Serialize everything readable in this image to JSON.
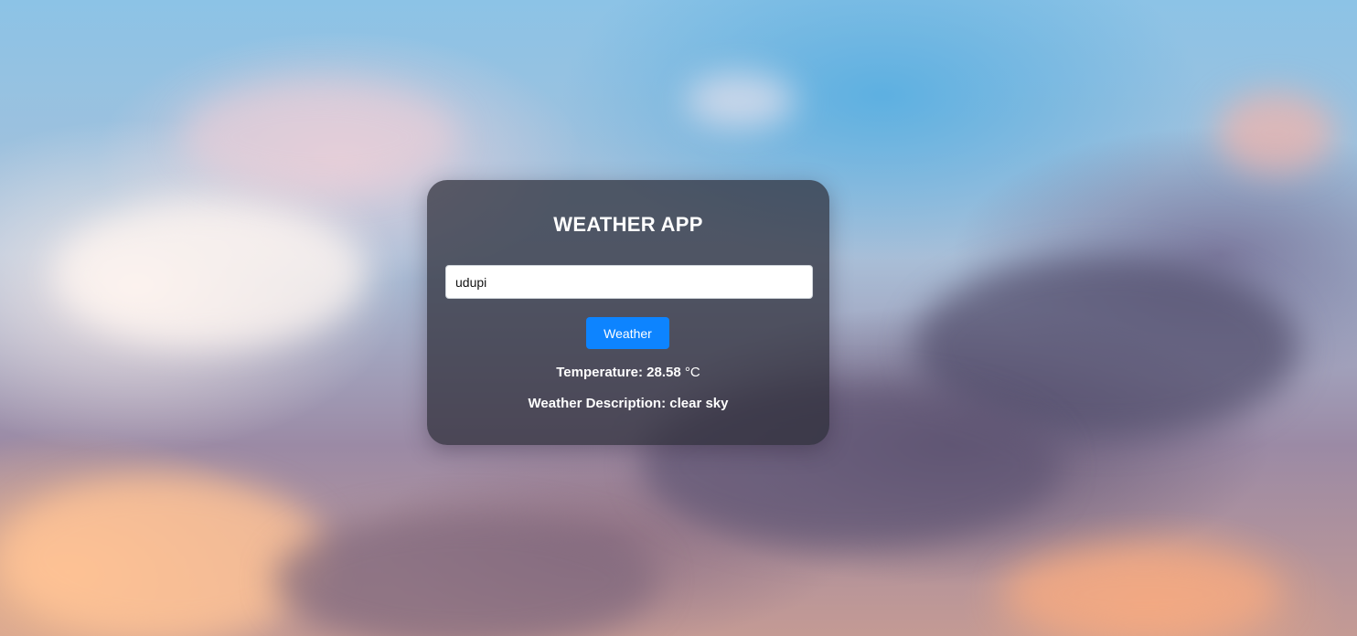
{
  "app": {
    "title": "WEATHER APP"
  },
  "search": {
    "value": "udupi",
    "button_label": "Weather"
  },
  "result": {
    "temperature_label": "Temperature:",
    "temperature_value": "28.58",
    "temperature_unit": "°C",
    "description_label": "Weather Description:",
    "description_value": "clear sky"
  },
  "colors": {
    "button": "#0d84ff",
    "card": "rgba(45,45,55,0.72)",
    "text": "#ffffff"
  }
}
